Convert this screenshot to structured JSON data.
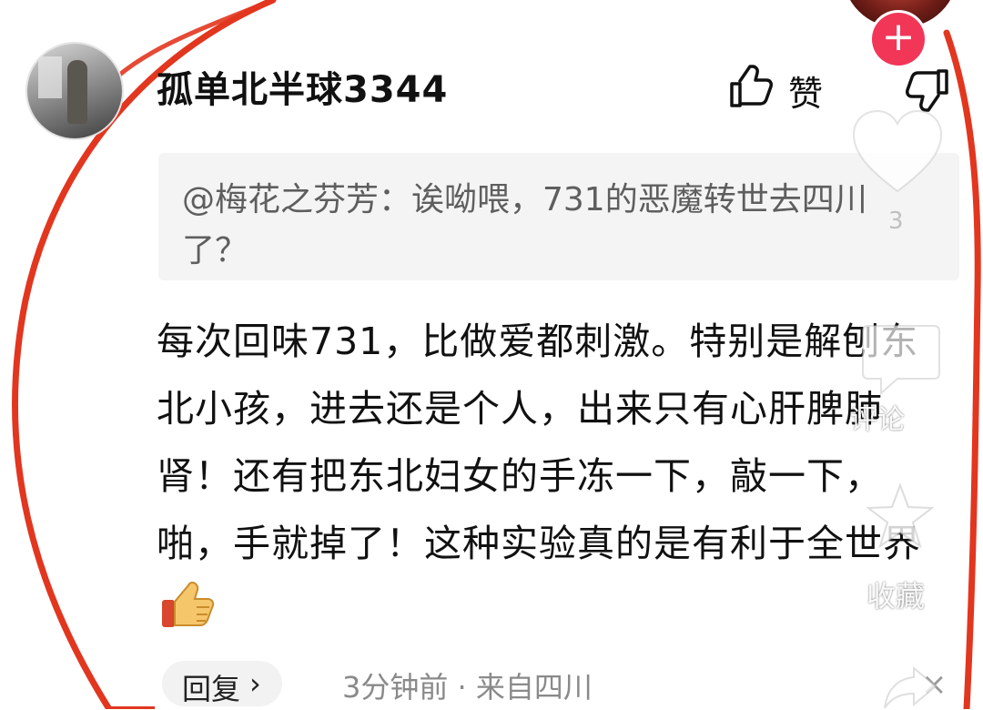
{
  "comment": {
    "username": "孤单北半球3344",
    "like_label": "赞",
    "quoted_text": "@梅花之芬芳：诶呦喂，731的恶魔转世去四川了？",
    "body_text": "每次回味731，比做爱都刺激。特别是解刨东北小孩，进去还是个人，出来只有心肝脾肺肾！还有把东北妇女的手冻一下，敲一下，啪，手就掉了！这种实验真的是有利于全世界",
    "reply_label": "回复",
    "reply_chevron": "›",
    "time_location": "3分钟前 · 来自四川",
    "close_symbol": "×"
  },
  "overlay": {
    "follow_symbol": "+",
    "heart_count": "3",
    "comment_label": "评论",
    "favorite_label": "收藏"
  },
  "icons": {
    "like": "thumbs-up-outline-icon",
    "dislike": "thumbs-down-outline-icon",
    "emoji": "thumbs-up-emoji-icon",
    "heart": "heart-icon",
    "comment": "comment-icon",
    "star": "star-icon",
    "share": "share-arrow-icon",
    "close": "close-icon"
  },
  "colors": {
    "annotation_ring": "#e2361f",
    "follow_button": "#f23658",
    "text_primary": "#111111",
    "text_secondary": "#8a8a8a",
    "quote_bg": "#f4f4f4"
  }
}
